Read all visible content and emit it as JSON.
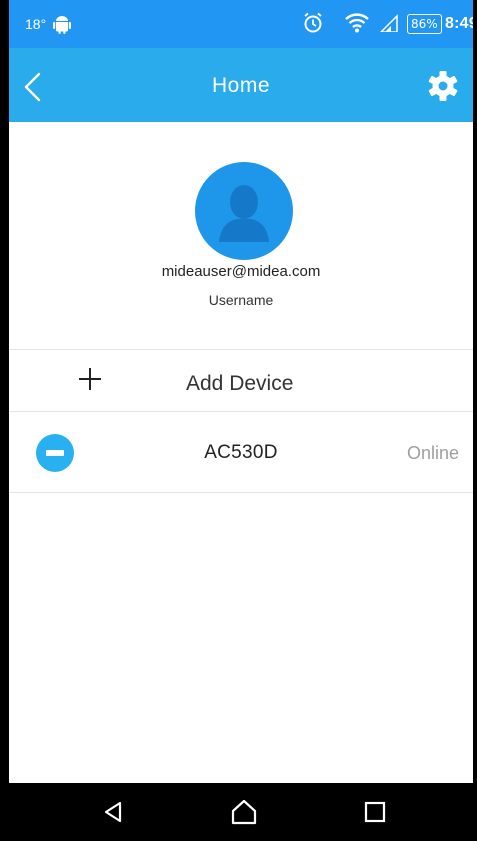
{
  "status_bar": {
    "temperature": "18°",
    "battery": "86%",
    "time": "8:49",
    "icons": [
      "android-icon",
      "alarm-icon",
      "wifi-icon",
      "signal-icon",
      "battery-icon"
    ]
  },
  "header": {
    "title": "Home",
    "back_icon": "chevron-left-icon",
    "settings_icon": "gear-icon",
    "color": "#29abec"
  },
  "profile": {
    "email": "mideauser@midea.com",
    "username": "Username",
    "avatar_icon": "user-icon"
  },
  "actions": {
    "add_device_label": "Add Device",
    "add_icon": "plus-icon"
  },
  "devices": [
    {
      "name": "AC530D",
      "status": "Online",
      "icon": "air-conditioner-icon"
    }
  ],
  "nav": {
    "icons": [
      "back-triangle-icon",
      "home-icon",
      "recents-icon"
    ]
  }
}
